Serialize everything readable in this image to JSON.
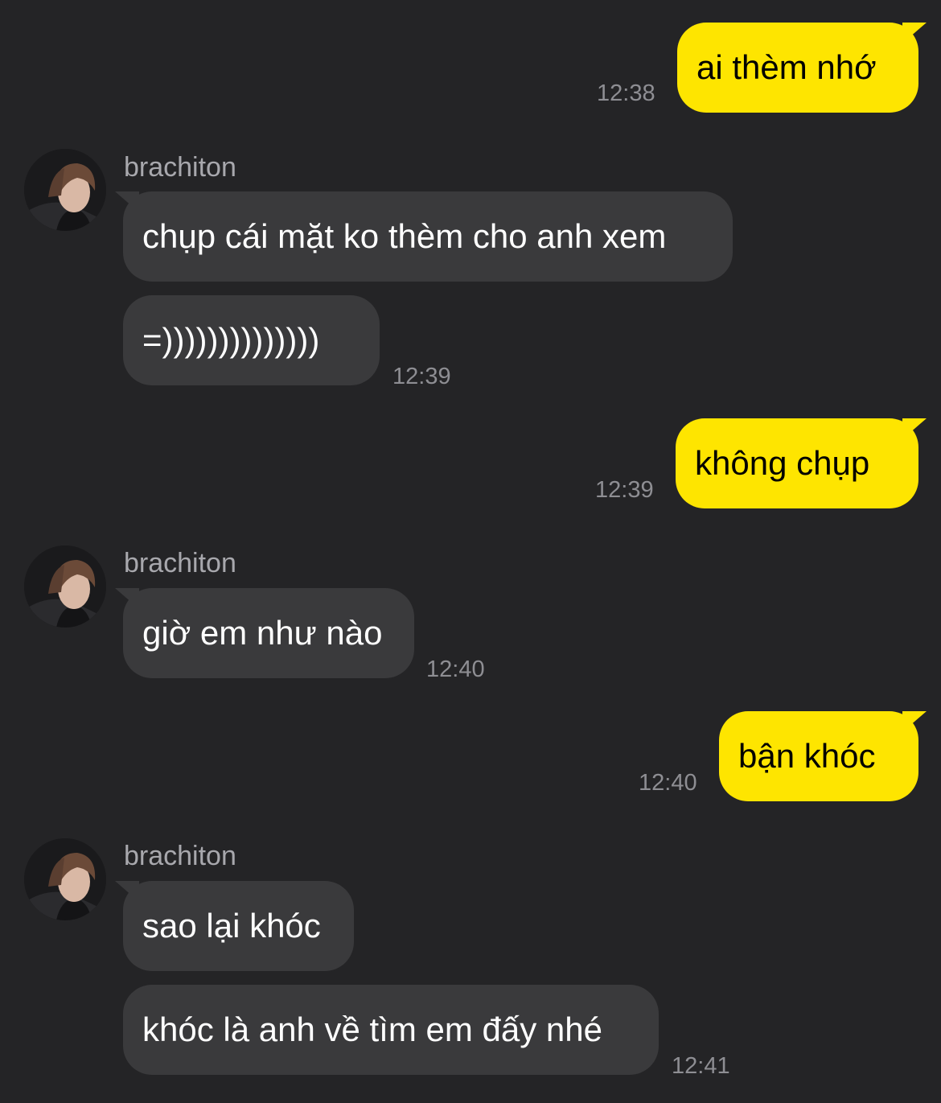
{
  "sender_name": "brachiton",
  "messages": [
    {
      "direction": "sent",
      "text": "ai thèm nhớ",
      "time": "12:38"
    },
    {
      "direction": "received",
      "text": "chụp cái mặt ko thèm cho anh xem"
    },
    {
      "direction": "received",
      "text": "=))))))))))))))",
      "time": "12:39"
    },
    {
      "direction": "sent",
      "text": "không chụp",
      "time": "12:39"
    },
    {
      "direction": "received",
      "text": "giờ em như nào",
      "time": "12:40"
    },
    {
      "direction": "sent",
      "text": "bận khóc",
      "time": "12:40"
    },
    {
      "direction": "received",
      "text": "sao lại khóc"
    },
    {
      "direction": "received",
      "text": "khóc là anh về tìm em đấy nhé",
      "time": "12:41"
    }
  ],
  "colors": {
    "background": "#242426",
    "sent_bubble": "#fee500",
    "received_bubble": "#3a3a3c",
    "timestamp": "#8e8e93",
    "sender_name": "#a8a8ad"
  },
  "icons": {
    "avatar": "profile-photo-avatar-icon"
  }
}
